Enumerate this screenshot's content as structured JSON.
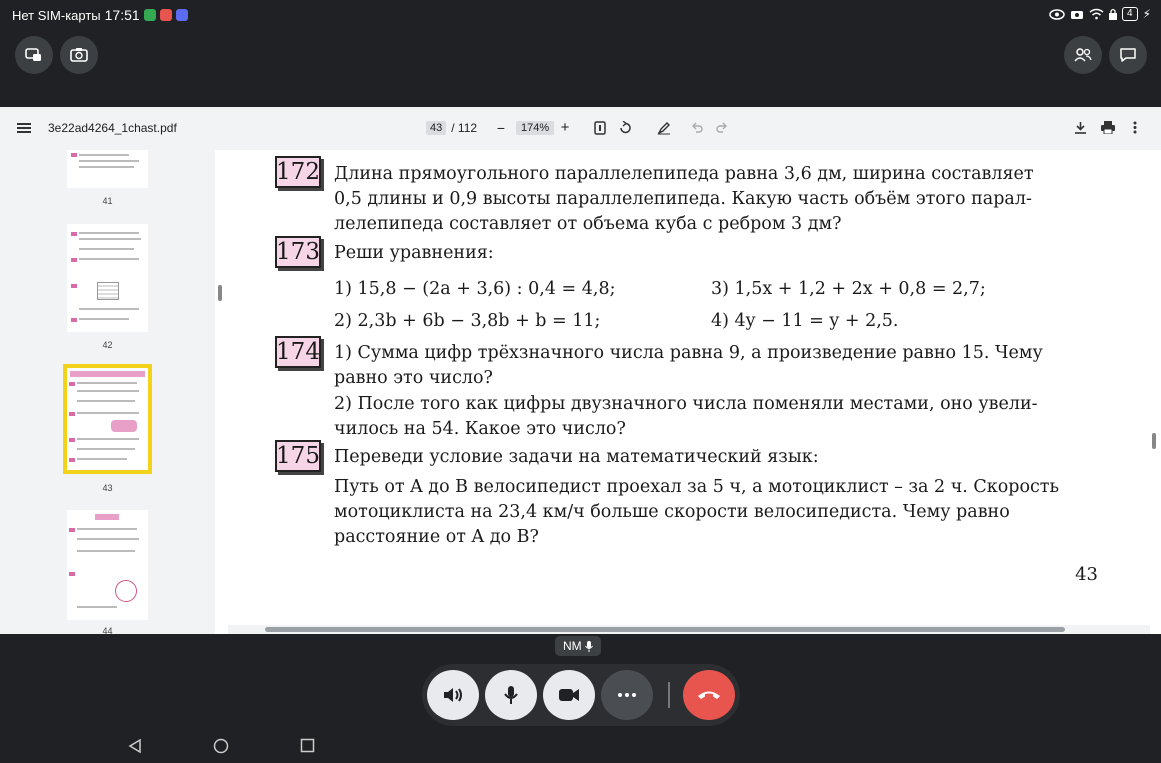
{
  "status_bar": {
    "carrier": "Нет SIM-карты",
    "time": "17:51",
    "battery": "4"
  },
  "viewer": {
    "filename": "3e22ad4264_1chast.pdf",
    "current_page": "43",
    "total_pages": "/ 112",
    "zoom": "174%",
    "minus": "−",
    "plus": "+"
  },
  "thumbnails": [
    {
      "label": "41"
    },
    {
      "label": "42"
    },
    {
      "label": "43"
    },
    {
      "label": "44"
    }
  ],
  "page": {
    "problems": [
      {
        "number": "172",
        "lines": [
          "Длина прямоугольного параллелепипеда равна 3,6 дм, ширина составляет",
          "0,5 длины и 0,9 высоты параллелепипеда. Какую часть объём этого парал-",
          "лелепипеда составляет от объема куба с ребром 3 дм?"
        ]
      },
      {
        "number": "173",
        "lines": [
          "Реши уравнения:"
        ],
        "equations": [
          "1) 15,8 − (2a + 3,6) : 0,4 = 4,8;",
          "3) 1,5x + 1,2 + 2x + 0,8 = 2,7;",
          "2) 2,3b + 6b − 3,8b + b = 11;",
          "4) 4y − 11 = y + 2,5."
        ]
      },
      {
        "number": "174",
        "lines": [
          "1) Сумма цифр трёхзначного числа равна 9, а произведение равно 15. Чему",
          "равно это число?",
          "2) После того как цифры двузначного числа поменяли местами, оно увели-",
          "чилось на 54. Какое это число?"
        ]
      },
      {
        "number": "175",
        "lines": [
          "Переведи условие задачи на математический язык:",
          "Путь от A до B велосипедист проехал за 5 ч, а мотоциклист – за 2 ч. Скорость",
          "мотоциклиста на 23,4 км/ч больше скорости велосипедиста. Чему равно",
          "расстояние от A до B?"
        ]
      }
    ],
    "page_number": "43"
  },
  "call": {
    "participant": "NM"
  },
  "colors": {
    "badge_fill": "#f6d6e6",
    "end_call": "#e8554e",
    "selected_thumb_border": "#f2d21b"
  }
}
